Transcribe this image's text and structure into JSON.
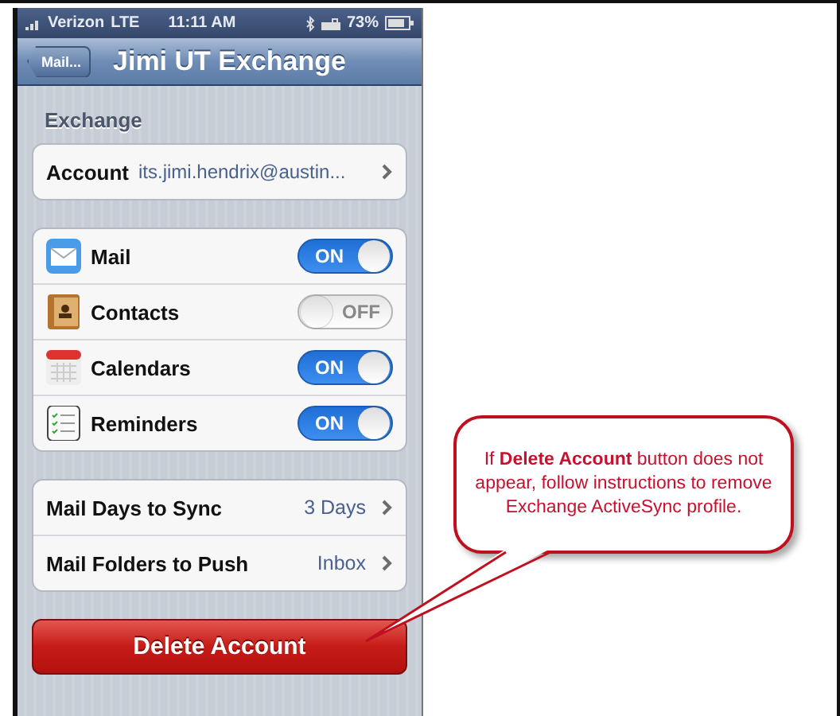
{
  "status_bar": {
    "carrier": "Verizon",
    "network": "LTE",
    "time": "11:11 AM",
    "battery": "73%"
  },
  "nav_bar": {
    "back_button": "Mail...",
    "title": "Jimi UT Exchange"
  },
  "section_header": "Exchange",
  "account_row": {
    "label": "Account",
    "value": "its.jimi.hendrix@austin..."
  },
  "toggles": [
    {
      "kind": "mail",
      "label": "Mail",
      "on": true,
      "switch_label": "ON"
    },
    {
      "kind": "contacts",
      "label": "Contacts",
      "on": false,
      "switch_label": "OFF"
    },
    {
      "kind": "calendars",
      "label": "Calendars",
      "on": true,
      "switch_label": "ON"
    },
    {
      "kind": "reminders",
      "label": "Reminders",
      "on": true,
      "switch_label": "ON"
    }
  ],
  "settings": [
    {
      "label": "Mail Days to Sync",
      "value": "3 Days"
    },
    {
      "label": "Mail Folders to Push",
      "value": "Inbox"
    }
  ],
  "delete_button": "Delete Account",
  "callout": {
    "text": "If **Delete Account** button does not appear, follow instructions to remove Exchange ActiveSync profile."
  }
}
